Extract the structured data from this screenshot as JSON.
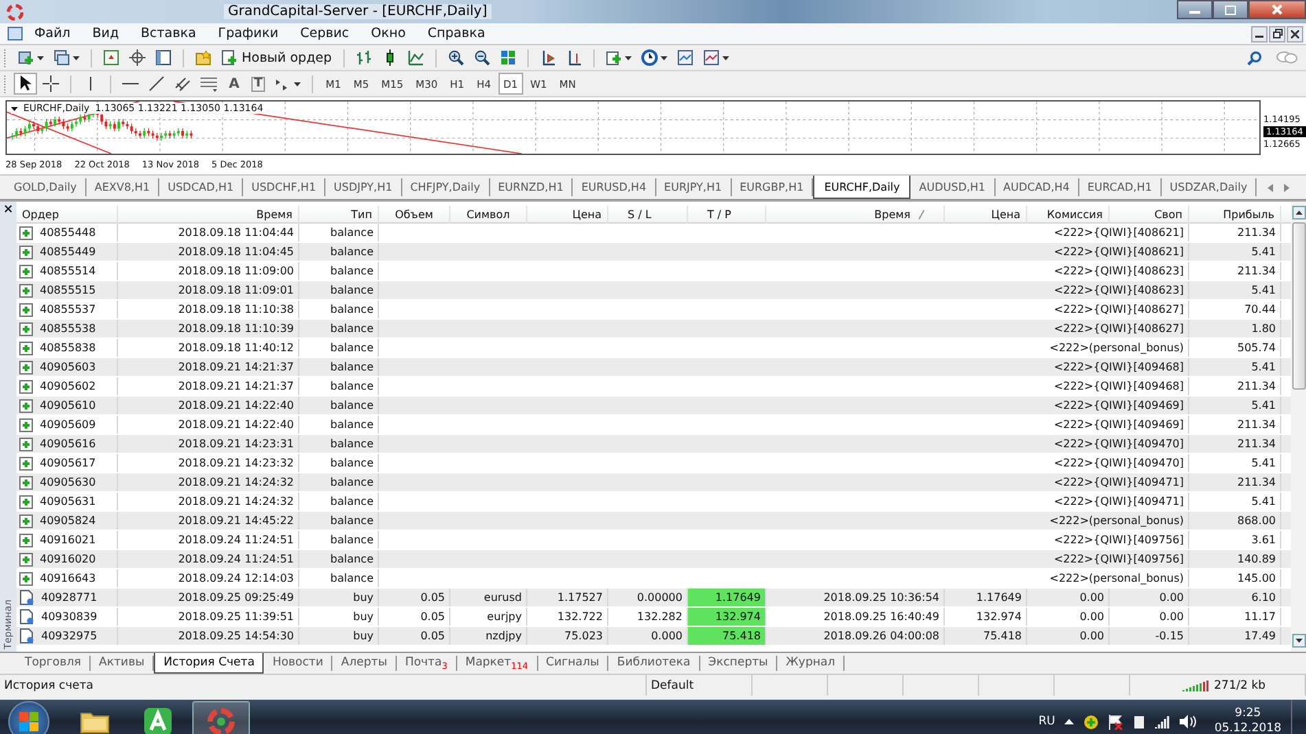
{
  "window": {
    "title": "GrandCapital-Server - [EURCHF,Daily]"
  },
  "menu": [
    "Файл",
    "Вид",
    "Вставка",
    "Графики",
    "Сервис",
    "Окно",
    "Справка"
  ],
  "toolbar": {
    "new_order": "Новый ордер",
    "text_tool": "A",
    "label_tool": "T"
  },
  "timeframes": [
    {
      "label": "M1",
      "selected": false
    },
    {
      "label": "M5",
      "selected": false
    },
    {
      "label": "M15",
      "selected": false
    },
    {
      "label": "M30",
      "selected": false
    },
    {
      "label": "H1",
      "selected": false
    },
    {
      "label": "H4",
      "selected": false
    },
    {
      "label": "D1",
      "selected": true
    },
    {
      "label": "W1",
      "selected": false
    },
    {
      "label": "MN",
      "selected": false
    }
  ],
  "chart": {
    "symbol": "EURCHF,Daily",
    "quote": "1.13065 1.13221 1.13050 1.13164",
    "dates": [
      "28 Sep 2018",
      "22 Oct 2018",
      "13 Nov 2018",
      "5 Dec 2018"
    ],
    "price_labels": [
      {
        "text": "1.14195",
        "current": false
      },
      {
        "text": "1.13164",
        "current": true
      },
      {
        "text": "1.12665",
        "current": false
      }
    ]
  },
  "chart_tabs": [
    {
      "label": "GOLD,Daily",
      "selected": false
    },
    {
      "label": "AEXV8,H1",
      "selected": false
    },
    {
      "label": "USDCAD,H1",
      "selected": false
    },
    {
      "label": "USDCHF,H1",
      "selected": false
    },
    {
      "label": "USDJPY,H1",
      "selected": false
    },
    {
      "label": "CHFJPY,Daily",
      "selected": false
    },
    {
      "label": "EURNZD,H1",
      "selected": false
    },
    {
      "label": "EURUSD,H4",
      "selected": false
    },
    {
      "label": "EURJPY,H1",
      "selected": false
    },
    {
      "label": "EURGBP,H1",
      "selected": false
    },
    {
      "label": "EURCHF,Daily",
      "selected": true
    },
    {
      "label": "AUDUSD,H1",
      "selected": false
    },
    {
      "label": "AUDCAD,H4",
      "selected": false
    },
    {
      "label": "EURCAD,H1",
      "selected": false
    },
    {
      "label": "USDZAR,Daily",
      "selected": false
    }
  ],
  "terminal": {
    "side_label": "Терминал",
    "close": "×"
  },
  "columns": [
    "Ордер",
    "Время",
    "Тип",
    "Объем",
    "Символ",
    "Цена",
    "S / L",
    "T / P",
    "Время",
    "Цена",
    "Комиссия",
    "Своп",
    "Прибыль"
  ],
  "rows": [
    {
      "kind": "balance",
      "order": "40855448",
      "time": "2018.09.18 11:04:44",
      "type": "balance",
      "comment": "<222>{QIWI}[408621]",
      "profit": "211.34"
    },
    {
      "kind": "balance",
      "order": "40855449",
      "time": "2018.09.18 11:04:45",
      "type": "balance",
      "comment": "<222>{QIWI}[408621]",
      "profit": "5.41"
    },
    {
      "kind": "balance",
      "order": "40855514",
      "time": "2018.09.18 11:09:00",
      "type": "balance",
      "comment": "<222>{QIWI}[408623]",
      "profit": "211.34"
    },
    {
      "kind": "balance",
      "order": "40855515",
      "time": "2018.09.18 11:09:01",
      "type": "balance",
      "comment": "<222>{QIWI}[408623]",
      "profit": "5.41"
    },
    {
      "kind": "balance",
      "order": "40855537",
      "time": "2018.09.18 11:10:38",
      "type": "balance",
      "comment": "<222>{QIWI}[408627]",
      "profit": "70.44"
    },
    {
      "kind": "balance",
      "order": "40855538",
      "time": "2018.09.18 11:10:39",
      "type": "balance",
      "comment": "<222>{QIWI}[408627]",
      "profit": "1.80"
    },
    {
      "kind": "balance",
      "order": "40855838",
      "time": "2018.09.18 11:40:12",
      "type": "balance",
      "comment": "<222>(personal_bonus)",
      "profit": "505.74"
    },
    {
      "kind": "balance",
      "order": "40905603",
      "time": "2018.09.21 14:21:37",
      "type": "balance",
      "comment": "<222>{QIWI}[409468]",
      "profit": "5.41"
    },
    {
      "kind": "balance",
      "order": "40905602",
      "time": "2018.09.21 14:21:37",
      "type": "balance",
      "comment": "<222>{QIWI}[409468]",
      "profit": "211.34"
    },
    {
      "kind": "balance",
      "order": "40905610",
      "time": "2018.09.21 14:22:40",
      "type": "balance",
      "comment": "<222>{QIWI}[409469]",
      "profit": "5.41"
    },
    {
      "kind": "balance",
      "order": "40905609",
      "time": "2018.09.21 14:22:40",
      "type": "balance",
      "comment": "<222>{QIWI}[409469]",
      "profit": "211.34"
    },
    {
      "kind": "balance",
      "order": "40905616",
      "time": "2018.09.21 14:23:31",
      "type": "balance",
      "comment": "<222>{QIWI}[409470]",
      "profit": "211.34"
    },
    {
      "kind": "balance",
      "order": "40905617",
      "time": "2018.09.21 14:23:32",
      "type": "balance",
      "comment": "<222>{QIWI}[409470]",
      "profit": "5.41"
    },
    {
      "kind": "balance",
      "order": "40905630",
      "time": "2018.09.21 14:24:32",
      "type": "balance",
      "comment": "<222>{QIWI}[409471]",
      "profit": "211.34"
    },
    {
      "kind": "balance",
      "order": "40905631",
      "time": "2018.09.21 14:24:32",
      "type": "balance",
      "comment": "<222>{QIWI}[409471]",
      "profit": "5.41"
    },
    {
      "kind": "balance",
      "order": "40905824",
      "time": "2018.09.21 14:45:22",
      "type": "balance",
      "comment": "<222>(personal_bonus)",
      "profit": "868.00"
    },
    {
      "kind": "balance",
      "order": "40916021",
      "time": "2018.09.24 11:24:51",
      "type": "balance",
      "comment": "<222>{QIWI}[409756]",
      "profit": "3.61"
    },
    {
      "kind": "balance",
      "order": "40916020",
      "time": "2018.09.24 11:24:51",
      "type": "balance",
      "comment": "<222>{QIWI}[409756]",
      "profit": "140.89"
    },
    {
      "kind": "balance",
      "order": "40916643",
      "time": "2018.09.24 12:14:03",
      "type": "balance",
      "comment": "<222>(personal_bonus)",
      "profit": "145.00"
    },
    {
      "kind": "trade",
      "order": "40928771",
      "time": "2018.09.25 09:25:49",
      "type": "buy",
      "volume": "0.05",
      "symbol": "eurusd",
      "price": "1.17527",
      "sl": "0.00000",
      "tp": "1.17649",
      "tp_hit": true,
      "close_time": "2018.09.25 10:36:54",
      "close_price": "1.17649",
      "commission": "0.00",
      "swap": "0.00",
      "profit": "6.10"
    },
    {
      "kind": "trade",
      "order": "40930839",
      "time": "2018.09.25 11:39:51",
      "type": "buy",
      "volume": "0.05",
      "symbol": "eurjpy",
      "price": "132.722",
      "sl": "132.282",
      "tp": "132.974",
      "tp_hit": true,
      "close_time": "2018.09.25 16:40:49",
      "close_price": "132.974",
      "commission": "0.00",
      "swap": "0.00",
      "profit": "11.17"
    },
    {
      "kind": "trade",
      "order": "40932975",
      "time": "2018.09.25 14:54:30",
      "type": "buy",
      "volume": "0.05",
      "symbol": "nzdjpy",
      "price": "75.023",
      "sl": "0.000",
      "tp": "75.418",
      "tp_hit": true,
      "close_time": "2018.09.26 04:00:08",
      "close_price": "75.418",
      "commission": "0.00",
      "swap": "-0.15",
      "profit": "17.49"
    }
  ],
  "terminal_tabs": [
    {
      "label": "Торговля",
      "selected": false
    },
    {
      "label": "Активы",
      "selected": false
    },
    {
      "label": "История Счета",
      "selected": true
    },
    {
      "label": "Новости",
      "selected": false
    },
    {
      "label": "Алерты",
      "selected": false
    },
    {
      "label": "Почта",
      "count": "3",
      "selected": false
    },
    {
      "label": "Маркет",
      "count": "114",
      "selected": false
    },
    {
      "label": "Сигналы",
      "selected": false
    },
    {
      "label": "Библиотека",
      "selected": false
    },
    {
      "label": "Эксперты",
      "selected": false
    },
    {
      "label": "Журнал",
      "selected": false
    }
  ],
  "status_bar": {
    "hint": "История счета",
    "profile": "Default",
    "traffic": "271/2 kb"
  },
  "taskbar": {
    "language": "RU",
    "time": "9:25",
    "date": "05.12.2018"
  }
}
